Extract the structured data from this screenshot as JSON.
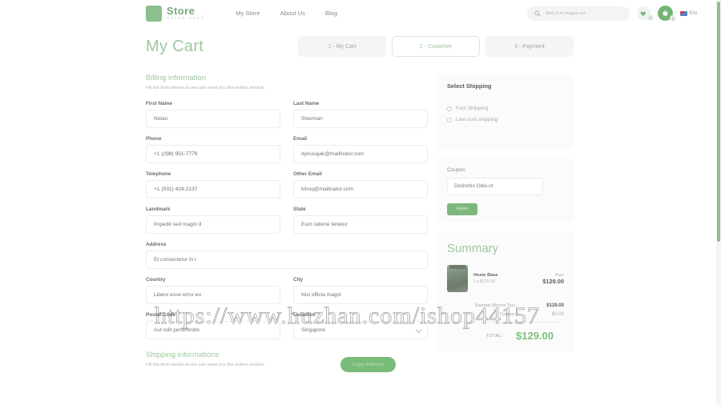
{
  "header": {
    "logo_title": "Store",
    "logo_sub": "SOLAR SHOP",
    "nav": [
      {
        "label": "My Store"
      },
      {
        "label": "About Us"
      },
      {
        "label": "Blog"
      }
    ],
    "search_placeholder": "Sed et in magna est",
    "wishlist_count": "0",
    "cart_count": "1",
    "lang_code": "EN"
  },
  "page": {
    "title": "My Cart",
    "steps": [
      {
        "label": "1 - My Cart",
        "active": false
      },
      {
        "label": "2 - Customer",
        "active": true
      },
      {
        "label": "3 - Payment",
        "active": false
      }
    ]
  },
  "billing": {
    "title": "Billing information",
    "subtitle": "Fill the form below so we can send you the orders invoice.",
    "fields": {
      "first_name_label": "First Name",
      "first_name_value": "Nolan",
      "last_name_label": "Last Name",
      "last_name_value": "Sherman",
      "phone_label": "Phone",
      "phone_value": "+1 (298) 951-7779",
      "email_label": "Email",
      "email_value": "dykusajak@mailinator.com",
      "telephone_label": "Telephone",
      "telephone_value": "+1 (931) 424-2137",
      "other_email_label": "Other Email",
      "other_email_value": "kihoq@mailinator.com",
      "landmark_label": "Landmark",
      "landmark_value": "Impedit sed magni d",
      "state_label": "State",
      "state_value": "Eum ratione tenetur",
      "address_label": "Address",
      "address_value": "Et consectetur in t",
      "country_label": "Country",
      "country_value": "Libero esse error eo",
      "city_label": "City",
      "city_value": "Nisi officia magni",
      "postal_code_label": "Postal Code",
      "postal_code_value": "Aut odit perferendis",
      "location_label": "Location",
      "location_value": "Singapore"
    }
  },
  "shipping_section": {
    "title": "Shipping informations",
    "subtitle": "Fill the form below so we can send you the orders invoice.",
    "copy_button": "Copy Address"
  },
  "select_shipping": {
    "title": "Select Shipping",
    "options": [
      {
        "label": "Fast Shipping",
        "selected": false
      },
      {
        "label": "Low cost shipping",
        "selected": false
      }
    ]
  },
  "coupon": {
    "label": "Coupon",
    "placeholder": "Distinctio Odio ut",
    "apply_label": "Apply"
  },
  "summary": {
    "title": "Summary",
    "product": {
      "name": "Home Base",
      "qty_line": "1 x $129.00",
      "price_caption": "Price",
      "price_value": "$129.00"
    },
    "totals": [
      {
        "label": "Subtotal (Before Tax) :",
        "value": "$129.00",
        "muted": false
      },
      {
        "label": "Coupon :",
        "value": "$0.00",
        "muted": true
      }
    ],
    "grand_label": "TOTAL :",
    "grand_value": "$129.00"
  },
  "watermark": {
    "text": "https://www.huzhan.com/ishop44157"
  },
  "colors": {
    "accent": "#7cb87c",
    "title_green": "#9ec79e",
    "cart_green": "#72b472",
    "panel_bg": "#fbfbfb"
  }
}
